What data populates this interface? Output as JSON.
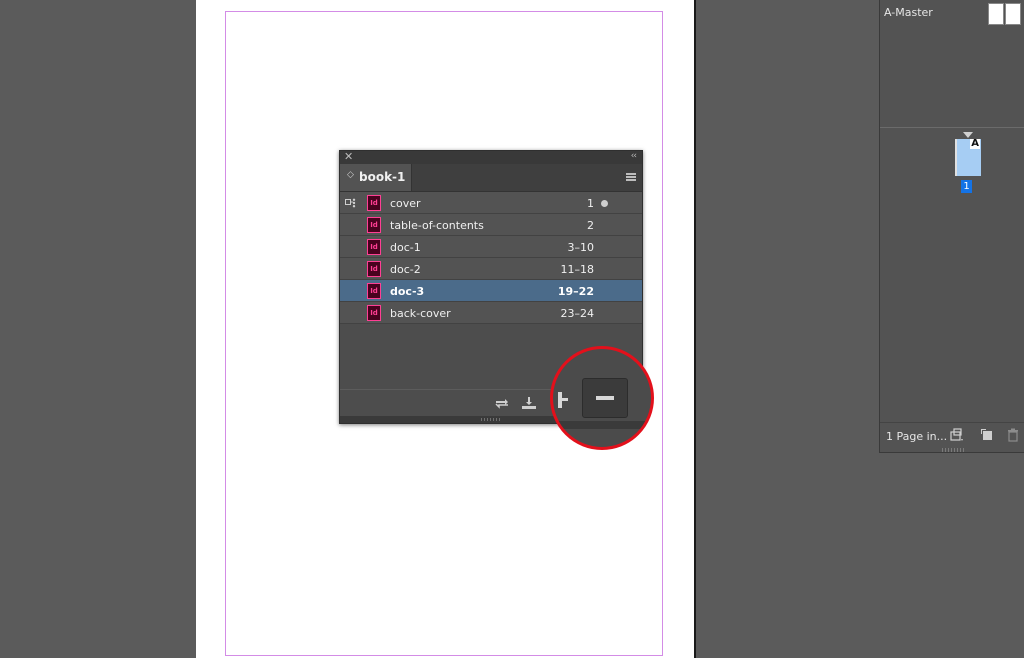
{
  "document": {
    "margin_color": "#d38ce6",
    "page_color": "#ffffff"
  },
  "pages_panel": {
    "master_label": "A-Master",
    "page_letter": "A",
    "page_number": "1",
    "footer_text": "1 Page in...",
    "icons": [
      "page-size-icon",
      "new-page-icon",
      "trash-icon"
    ]
  },
  "book_panel": {
    "close_glyph": "✕",
    "collapse_glyph": "‹‹",
    "tab": {
      "arrows": "◇",
      "label": "book-1"
    },
    "documents": [
      {
        "name": "cover",
        "pages": "1",
        "is_style_source": true,
        "status": "open"
      },
      {
        "name": "table-of-contents",
        "pages": "2"
      },
      {
        "name": "doc-1",
        "pages": "3–10"
      },
      {
        "name": "doc-2",
        "pages": "11–18"
      },
      {
        "name": "doc-3",
        "pages": "19–22",
        "selected": true
      },
      {
        "name": "back-cover",
        "pages": "23–24"
      }
    ],
    "doc_icon_label": "Id",
    "footer_icons": [
      "synchronize-icon",
      "save-book-icon",
      "print-book-icon",
      "add-document-icon",
      "remove-document-icon"
    ],
    "accent_color": "#4b6b8a"
  },
  "callout": {
    "color": "#e3101b",
    "highlighted_button": "remove-document-button"
  }
}
